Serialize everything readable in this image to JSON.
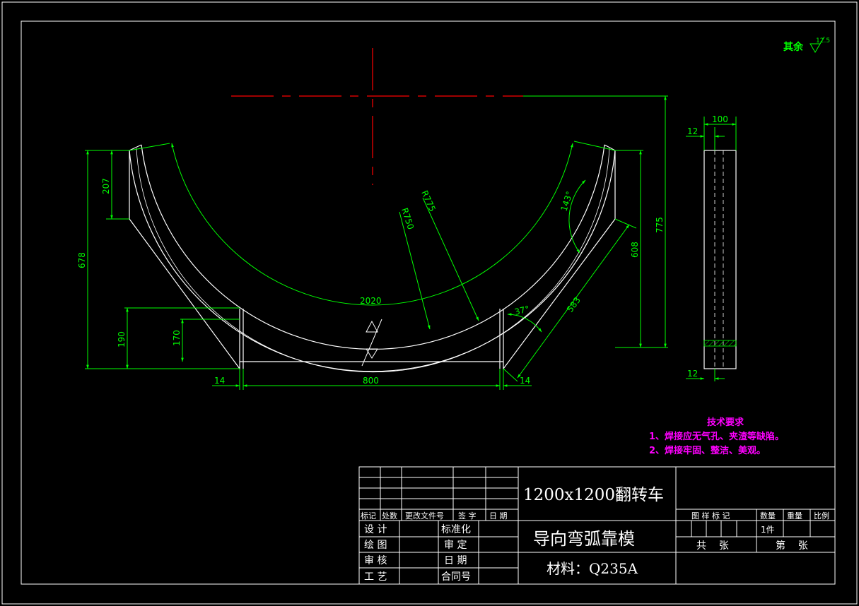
{
  "colors": {
    "background": "#000000",
    "geometry": "#ffffff",
    "dimension": "#00ff00",
    "centerline": "#ff0000",
    "notes": "#ff00ff",
    "surface_mark": "#00ff00"
  },
  "surface_finish": {
    "label": "其余",
    "value": "12.5"
  },
  "dimensions": {
    "left_top": "207",
    "left_total": "678",
    "left_190": "190",
    "left_170": "170",
    "bottom_14_left": "14",
    "bottom_800": "800",
    "bottom_14_right": "14",
    "arc_length": "2020",
    "r_inner": "R750",
    "r_outer": "R775",
    "angle_143": "143°",
    "angle_37": "37°",
    "slant_583": "583",
    "right_608": "608",
    "right_775": "775",
    "side_100": "100",
    "side_12_top": "12",
    "side_12_bottom": "12"
  },
  "technical_requirements": {
    "title": "技术要求",
    "items": [
      "1、焊接应无气孔、夹渣等缺陷。",
      "2、焊接牢固、整洁、美观。"
    ]
  },
  "title_block": {
    "project": "1200x1200翻转车",
    "part_name": "导向弯弧靠模",
    "material": "材料：Q235A",
    "revision_headers": [
      "标记",
      "处数",
      "更改文件号",
      "签 字",
      "日 期"
    ],
    "left_rows": [
      {
        "label": "设 计",
        "right_label": "标准化"
      },
      {
        "label": "绘 图",
        "right_label": "审 定"
      },
      {
        "label": "审 核",
        "right_label": "日 期"
      },
      {
        "label": "工 艺",
        "right_label": "合同号"
      }
    ],
    "right_headers": [
      "图 样 标 记",
      "数量",
      "重量",
      "比例"
    ],
    "quantity": "1件",
    "sheet_total_label": "共    张",
    "sheet_no_label": "第    张"
  }
}
